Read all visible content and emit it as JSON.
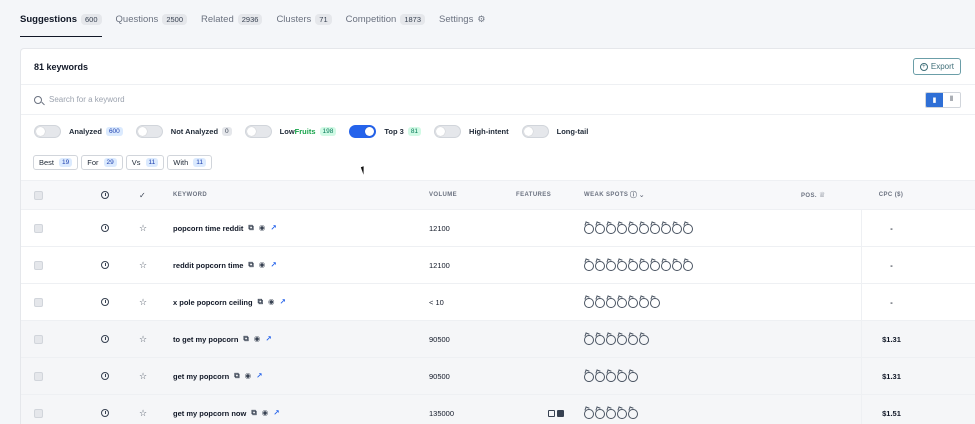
{
  "tabs": [
    {
      "label": "Suggestions",
      "count": "600",
      "active": true
    },
    {
      "label": "Questions",
      "count": "2500"
    },
    {
      "label": "Related",
      "count": "2936"
    },
    {
      "label": "Clusters",
      "count": "71"
    },
    {
      "label": "Competition",
      "count": "1873"
    },
    {
      "label": "Settings",
      "count": ""
    }
  ],
  "header": {
    "title": "81 keywords",
    "export_label": "Export"
  },
  "search": {
    "placeholder": "Search for a keyword",
    "value": ""
  },
  "filters": [
    {
      "label": "Analyzed",
      "count": "600",
      "on": false
    },
    {
      "label": "Not Analyzed",
      "count": "0",
      "on": false
    },
    {
      "label_a": "Low",
      "label_b": "Fruits",
      "count": "198",
      "on": false
    },
    {
      "label": "Top 3",
      "count": "81",
      "on": true
    },
    {
      "label": "High-intent",
      "count": "",
      "on": false
    },
    {
      "label": "Long-tail",
      "count": "",
      "on": false
    }
  ],
  "chips": [
    {
      "label": "Best",
      "count": "19"
    },
    {
      "label": "For",
      "count": "29"
    },
    {
      "label": "Vs",
      "count": "11"
    },
    {
      "label": "With",
      "count": "11"
    }
  ],
  "columns": {
    "keyword": "KEYWORD",
    "volume": "VOLUME",
    "features": "FEATURES",
    "weak_spots": "WEAK SPOTS",
    "pos": "POS.",
    "cpc": "CPC ($)"
  },
  "rows": [
    {
      "keyword": "popcorn time reddit",
      "volume": "12100",
      "weak_spots": 10,
      "features": 0,
      "cpc": "-"
    },
    {
      "keyword": "reddit popcorn time",
      "volume": "12100",
      "weak_spots": 10,
      "features": 0,
      "cpc": "-"
    },
    {
      "keyword": "x pole popcorn ceiling",
      "volume": "< 10",
      "weak_spots": 7,
      "features": 0,
      "cpc": "-"
    },
    {
      "keyword": "to get my popcorn",
      "volume": "90500",
      "weak_spots": 6,
      "features": 0,
      "cpc": "$1.31"
    },
    {
      "keyword": "get my popcorn",
      "volume": "90500",
      "weak_spots": 5,
      "features": 0,
      "cpc": "$1.31"
    },
    {
      "keyword": "get my popcorn now",
      "volume": "135000",
      "weak_spots": 5,
      "features": 2,
      "cpc": "$1.51"
    }
  ]
}
